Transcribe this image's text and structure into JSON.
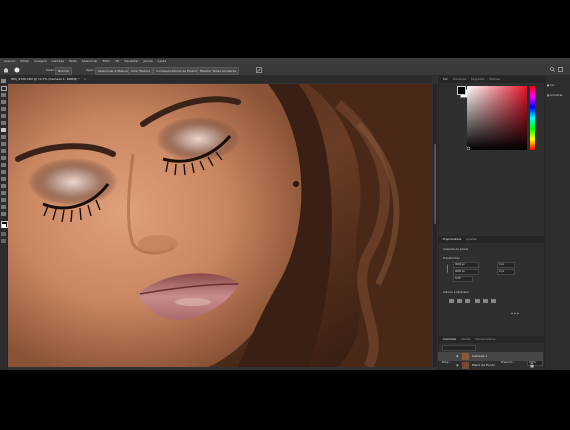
{
  "menubar": {
    "items": [
      "Arquivo",
      "Editar",
      "Imagem",
      "Camada",
      "Texto",
      "Selecionar",
      "Filtro",
      "3D",
      "Visualizar",
      "Janela",
      "Ajuda"
    ]
  },
  "options_bar": {
    "mode_label": "Modo:",
    "mode_value": "Normal",
    "opacity_label": "Opac.:",
    "buttons": [
      "Selecionar e Mascarar",
      "Criar Textura",
      "Correspondência de Proximidade"
    ],
    "sample_label": "Mostrar Todas Amostras"
  },
  "document": {
    "tab_title": "IMG_9726.CR2 @ 14,7% (Camada 1, RGB/8) *",
    "close_symbol": "×"
  },
  "color_panel": {
    "tabs": [
      "Cor",
      "Amostras",
      "Degradês",
      "Padrões"
    ]
  },
  "properties_panel": {
    "tabs": [
      "Propriedades",
      "Ajustes"
    ],
    "layer_type": "Camada de pixels",
    "transform_label": "Transformar",
    "width_value": "3000 px",
    "height_value": "4000 px",
    "x_value": "0 px",
    "y_value": "0 px",
    "angle_value": "0,00°",
    "align_label": "Alinhar e Distribuir"
  },
  "layers_panel": {
    "tabs": [
      "Camadas",
      "Canais",
      "Demarcadores"
    ],
    "blend_mode": "Normal",
    "opacity_label": "Opacidade:",
    "opacity_value": "100%",
    "fill_label": "Preench.:",
    "fill_value": "100%",
    "lock_label": "Bloq.:",
    "layers": [
      {
        "name": "Camada 1"
      },
      {
        "name": "Plano de Fundo"
      }
    ]
  },
  "right_strip": {
    "items": [
      "Cor",
      "Amostras"
    ]
  },
  "colors": {
    "accent_red": "#e5152a",
    "ui_dark": "#323232"
  }
}
